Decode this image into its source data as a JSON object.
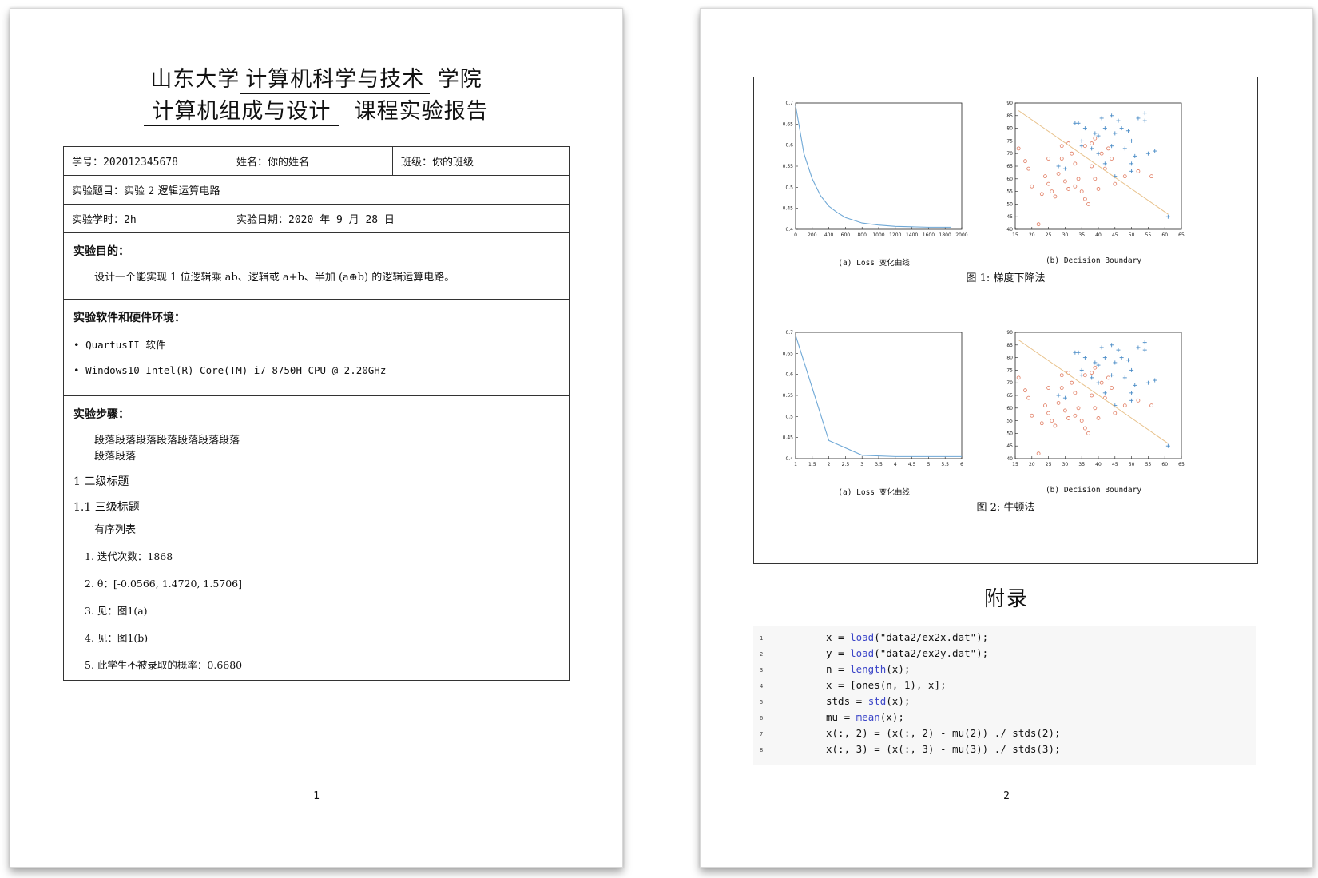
{
  "page1": {
    "title_line1": {
      "prefix": "山东大学",
      "college": "计算机科学与技术",
      "suffix": "学院"
    },
    "title_line2": {
      "course": "计算机组成与设计",
      "suffix": "课程实验报告"
    },
    "table": {
      "student_id_label": "学号：",
      "student_id": "202012345678",
      "name_label": "姓名：",
      "name": "你的姓名",
      "class_label": "班级：",
      "class": "你的班级",
      "topic_label": "实验题目：",
      "topic": "实验 2 逻辑运算电路",
      "hours_label": "实验学时：",
      "hours": "2h",
      "date_label": "实验日期：",
      "date": "2020 年 9 月 28 日"
    },
    "purpose": {
      "heading": "实验目的：",
      "text": "设计一个能实现 1 位逻辑乘 ab、逻辑或 a+b、半加 (a⊕b) 的逻辑运算电路。"
    },
    "env": {
      "heading": "实验软件和硬件环境：",
      "items": [
        "QuartusII 软件",
        "Windows10 Intel(R) Core(TM) i7-8750H CPU @ 2.20GHz"
      ]
    },
    "steps": {
      "heading": "实验步骤：",
      "para_line1": "段落段落段落段落段落段落段落",
      "para_line2": "段落段落",
      "h2": "1  二级标题",
      "h3": "1.1  三级标题",
      "list_intro": "有序列表",
      "list": [
        "1.  迭代次数：1868",
        "2.  θ：[-0.0566, 1.4720, 1.5706]",
        "3.  见：图1(a)",
        "4.  见：图1(b)",
        "5.  此学生不被录取的概率：0.6680"
      ]
    },
    "page_number": "1"
  },
  "page2": {
    "figure1": {
      "caption_a": "(a) Loss 变化曲线",
      "caption_b": "(b) Decision Boundary",
      "caption": "图 1:  梯度下降法"
    },
    "figure2": {
      "caption_a": "(a) Loss 变化曲线",
      "caption_b": "(b) Decision Boundary",
      "caption": "图 2:  牛顿法"
    },
    "appendix_title": "附录",
    "code": [
      [
        "x = ",
        "load",
        "(\"data2/ex2x.dat\");"
      ],
      [
        "y = ",
        "load",
        "(\"data2/ex2y.dat\");"
      ],
      [
        "n = ",
        "length",
        "(x);"
      ],
      [
        "x = [ones(n, 1), x];",
        "",
        ""
      ],
      [
        "stds = ",
        "std",
        "(x);"
      ],
      [
        "mu = ",
        "mean",
        "(x);"
      ],
      [
        "x(:, 2) = (x(:, 2) - mu(2)) ./ stds(2);",
        "",
        ""
      ],
      [
        "x(:, 3) = (x(:, 3) - mu(3)) ./ stds(3);",
        "",
        ""
      ]
    ],
    "page_number": "2"
  },
  "chart_data": [
    {
      "type": "line",
      "x": [
        1,
        100,
        200,
        300,
        400,
        500,
        600,
        800,
        1000,
        1200,
        1400,
        1600,
        1868
      ],
      "y": [
        0.693,
        0.58,
        0.52,
        0.48,
        0.455,
        0.44,
        0.428,
        0.415,
        0.41,
        0.407,
        0.406,
        0.405,
        0.405
      ],
      "xlim": [
        0,
        2000
      ],
      "ylim": [
        0.4,
        0.7
      ],
      "xticks": [
        0,
        200,
        400,
        600,
        800,
        1000,
        1200,
        1400,
        1600,
        1800,
        2000
      ],
      "yticks": [
        0.4,
        0.45,
        0.5,
        0.55,
        0.6,
        0.65,
        0.7
      ],
      "color": "#6fa8d6"
    },
    {
      "type": "scatter",
      "xlim": [
        15,
        65
      ],
      "ylim": [
        40,
        90
      ],
      "xticks": [
        15,
        20,
        25,
        30,
        35,
        40,
        45,
        50,
        55,
        60,
        65
      ],
      "yticks": [
        40,
        45,
        50,
        55,
        60,
        65,
        70,
        75,
        80,
        85,
        90
      ],
      "series": [
        {
          "marker": "cross",
          "color": "#4a8cc7",
          "points": [
            [
              33,
              82
            ],
            [
              34,
              82
            ],
            [
              36,
              80
            ],
            [
              39,
              78
            ],
            [
              40,
              77
            ],
            [
              41,
              84
            ],
            [
              42,
              80
            ],
            [
              44,
              85
            ],
            [
              45,
              78
            ],
            [
              46,
              83
            ],
            [
              47,
              80
            ],
            [
              49,
              79
            ],
            [
              50,
              75
            ],
            [
              51,
              69
            ],
            [
              52,
              84
            ],
            [
              54,
              86
            ],
            [
              54,
              83
            ],
            [
              55,
              70
            ],
            [
              57,
              71
            ],
            [
              28,
              65
            ],
            [
              30,
              64
            ],
            [
              35,
              75
            ],
            [
              38,
              72
            ],
            [
              40,
              70
            ],
            [
              42,
              66
            ],
            [
              45,
              61
            ],
            [
              48,
              72
            ],
            [
              50,
              66
            ],
            [
              50,
              63
            ],
            [
              61,
              45
            ],
            [
              35,
              73
            ],
            [
              44,
              73
            ]
          ]
        },
        {
          "marker": "circle",
          "color": "#e07a5f",
          "points": [
            [
              16,
              72
            ],
            [
              18,
              67
            ],
            [
              19,
              64
            ],
            [
              20,
              57
            ],
            [
              22,
              42
            ],
            [
              23,
              54
            ],
            [
              24,
              61
            ],
            [
              25,
              58
            ],
            [
              26,
              55
            ],
            [
              27,
              53
            ],
            [
              28,
              62
            ],
            [
              29,
              68
            ],
            [
              30,
              59
            ],
            [
              31,
              56
            ],
            [
              32,
              70
            ],
            [
              33,
              66
            ],
            [
              34,
              60
            ],
            [
              35,
              55
            ],
            [
              36,
              52
            ],
            [
              37,
              50
            ],
            [
              38,
              65
            ],
            [
              38,
              74
            ],
            [
              39,
              60
            ],
            [
              40,
              56
            ],
            [
              41,
              70
            ],
            [
              42,
              64
            ],
            [
              43,
              72
            ],
            [
              44,
              68
            ],
            [
              36,
              73
            ],
            [
              39,
              76
            ],
            [
              45,
              58
            ],
            [
              48,
              61
            ],
            [
              52,
              63
            ],
            [
              56,
              61
            ],
            [
              31,
              74
            ],
            [
              29,
              73
            ],
            [
              25,
              68
            ],
            [
              33,
              57
            ]
          ]
        },
        {
          "marker": "line",
          "color": "#e8c18a",
          "points": [
            [
              16,
              87
            ],
            [
              61,
              46
            ]
          ]
        }
      ]
    },
    {
      "type": "line",
      "x": [
        1,
        2,
        3,
        4,
        5,
        6
      ],
      "y": [
        0.693,
        0.443,
        0.408,
        0.405,
        0.405,
        0.405
      ],
      "xlim": [
        1,
        6
      ],
      "ylim": [
        0.4,
        0.7
      ],
      "xticks": [
        1,
        1.5,
        2,
        2.5,
        3,
        3.5,
        4,
        4.5,
        5,
        5.5,
        6
      ],
      "yticks": [
        0.4,
        0.45,
        0.5,
        0.55,
        0.6,
        0.65,
        0.7
      ],
      "color": "#6fa8d6"
    },
    {
      "type": "scatter",
      "xlim": [
        15,
        65
      ],
      "ylim": [
        40,
        90
      ],
      "xticks": [
        15,
        20,
        25,
        30,
        35,
        40,
        45,
        50,
        55,
        60,
        65
      ],
      "yticks": [
        40,
        45,
        50,
        55,
        60,
        65,
        70,
        75,
        80,
        85,
        90
      ],
      "series": [
        {
          "marker": "cross",
          "color": "#4a8cc7",
          "points": [
            [
              33,
              82
            ],
            [
              34,
              82
            ],
            [
              36,
              80
            ],
            [
              39,
              78
            ],
            [
              40,
              77
            ],
            [
              41,
              84
            ],
            [
              42,
              80
            ],
            [
              44,
              85
            ],
            [
              45,
              78
            ],
            [
              46,
              83
            ],
            [
              47,
              80
            ],
            [
              49,
              79
            ],
            [
              50,
              75
            ],
            [
              51,
              69
            ],
            [
              52,
              84
            ],
            [
              54,
              86
            ],
            [
              54,
              83
            ],
            [
              55,
              70
            ],
            [
              57,
              71
            ],
            [
              28,
              65
            ],
            [
              30,
              64
            ],
            [
              35,
              75
            ],
            [
              38,
              72
            ],
            [
              40,
              70
            ],
            [
              42,
              66
            ],
            [
              45,
              61
            ],
            [
              48,
              72
            ],
            [
              50,
              66
            ],
            [
              50,
              63
            ],
            [
              61,
              45
            ],
            [
              35,
              73
            ],
            [
              44,
              73
            ]
          ]
        },
        {
          "marker": "circle",
          "color": "#e07a5f",
          "points": [
            [
              16,
              72
            ],
            [
              18,
              67
            ],
            [
              19,
              64
            ],
            [
              20,
              57
            ],
            [
              22,
              42
            ],
            [
              23,
              54
            ],
            [
              24,
              61
            ],
            [
              25,
              58
            ],
            [
              26,
              55
            ],
            [
              27,
              53
            ],
            [
              28,
              62
            ],
            [
              29,
              68
            ],
            [
              30,
              59
            ],
            [
              31,
              56
            ],
            [
              32,
              70
            ],
            [
              33,
              66
            ],
            [
              34,
              60
            ],
            [
              35,
              55
            ],
            [
              36,
              52
            ],
            [
              37,
              50
            ],
            [
              38,
              65
            ],
            [
              38,
              74
            ],
            [
              39,
              60
            ],
            [
              40,
              56
            ],
            [
              41,
              70
            ],
            [
              42,
              64
            ],
            [
              43,
              72
            ],
            [
              44,
              68
            ],
            [
              36,
              73
            ],
            [
              39,
              76
            ],
            [
              45,
              58
            ],
            [
              48,
              61
            ],
            [
              52,
              63
            ],
            [
              56,
              61
            ],
            [
              31,
              74
            ],
            [
              29,
              73
            ],
            [
              25,
              68
            ],
            [
              33,
              57
            ]
          ]
        },
        {
          "marker": "line",
          "color": "#e8c18a",
          "points": [
            [
              16,
              87
            ],
            [
              61,
              46
            ]
          ]
        }
      ]
    }
  ]
}
